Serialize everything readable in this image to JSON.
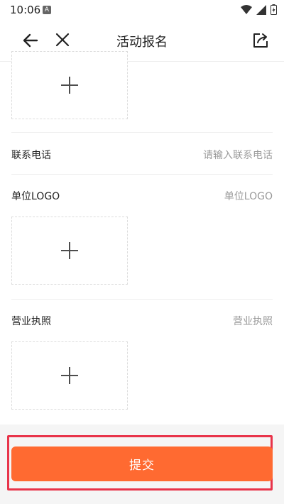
{
  "status_bar": {
    "time": "10:06",
    "notification_badge": "A"
  },
  "nav": {
    "title": "活动报名",
    "icons": {
      "back": "arrow-left-icon",
      "close": "close-icon",
      "share": "share-icon"
    }
  },
  "form": {
    "phone": {
      "label": "联系电话",
      "placeholder": "请输入联系电话"
    },
    "logo": {
      "label": "单位LOGO",
      "hint": "单位LOGO"
    },
    "license": {
      "label": "营业执照",
      "hint": "营业执照"
    }
  },
  "submit": {
    "label": "提交"
  },
  "colors": {
    "accent": "#ff6a31",
    "highlight": "#e8344a",
    "hint_text": "#9a9a9a"
  }
}
